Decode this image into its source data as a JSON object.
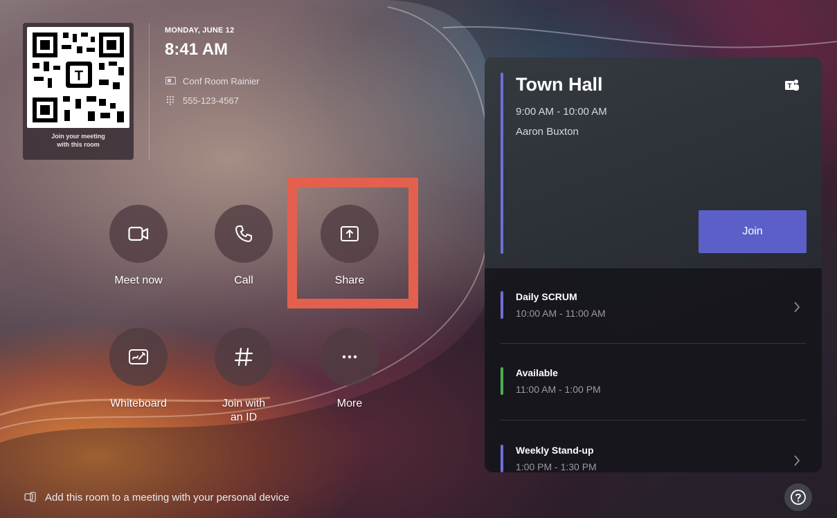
{
  "room": {
    "date": "MONDAY, JUNE 12",
    "time": "8:41 AM",
    "room_name": "Conf Room Rainier",
    "phone": "555-123-4567",
    "qr_caption_line1": "Join your meeting",
    "qr_caption_line2": "with this room"
  },
  "actions": [
    {
      "label": "Meet now",
      "icon": "video-camera-icon"
    },
    {
      "label": "Call",
      "icon": "phone-icon"
    },
    {
      "label": "Share",
      "icon": "share-screen-icon"
    },
    {
      "label": "Whiteboard",
      "icon": "whiteboard-icon"
    },
    {
      "label_line1": "Join with",
      "label_line2": "an ID",
      "icon": "hash-icon"
    },
    {
      "label": "More",
      "icon": "ellipsis-icon"
    }
  ],
  "featured_meeting": {
    "title": "Town Hall",
    "time": "9:00 AM - 10:00 AM",
    "organizer": "Aaron Buxton",
    "join_label": "Join",
    "accent_color": "#6f6fd6"
  },
  "meetings": [
    {
      "title": "Daily SCRUM",
      "time": "10:00 AM - 11:00 AM",
      "color": "#6f6fd6"
    },
    {
      "title": "Available",
      "time": "11:00 AM - 1:00 PM",
      "color": "#4caf50"
    },
    {
      "title": "Weekly Stand-up",
      "time": "1:00 PM - 1:30 PM",
      "color": "#6f6fd6"
    }
  ],
  "footer": {
    "text": "Add this room to a meeting with your personal device"
  },
  "colors": {
    "highlight": "#e4604e",
    "join_button": "#5b5fc7"
  }
}
